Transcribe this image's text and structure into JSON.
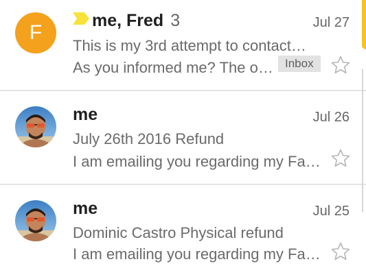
{
  "emails": [
    {
      "avatar_letter": "F",
      "avatar_color": "#f4a11e",
      "sender": "me, Fred",
      "thread_count": "3",
      "date": "Jul 27",
      "subject": "This is my 3rd attempt to contact…",
      "snippet": "As you informed me? The o…",
      "label": "Inbox",
      "important": true,
      "unread": true
    },
    {
      "avatar": "user-photo",
      "sender": "me",
      "date": "Jul 26",
      "subject": "July 26th 2016 Refund",
      "snippet": "I am emailing you regarding my Fa…",
      "unread": true
    },
    {
      "avatar": "user-photo",
      "sender": "me",
      "date": "Jul 25",
      "subject": "Dominic Castro Physical refund",
      "snippet": "I am emailing you regarding my Fa…",
      "unread": true
    }
  ],
  "colors": {
    "accent": "#f6c325",
    "importance_marker": "#f7e23a",
    "avatar_orange": "#f4a11e"
  }
}
